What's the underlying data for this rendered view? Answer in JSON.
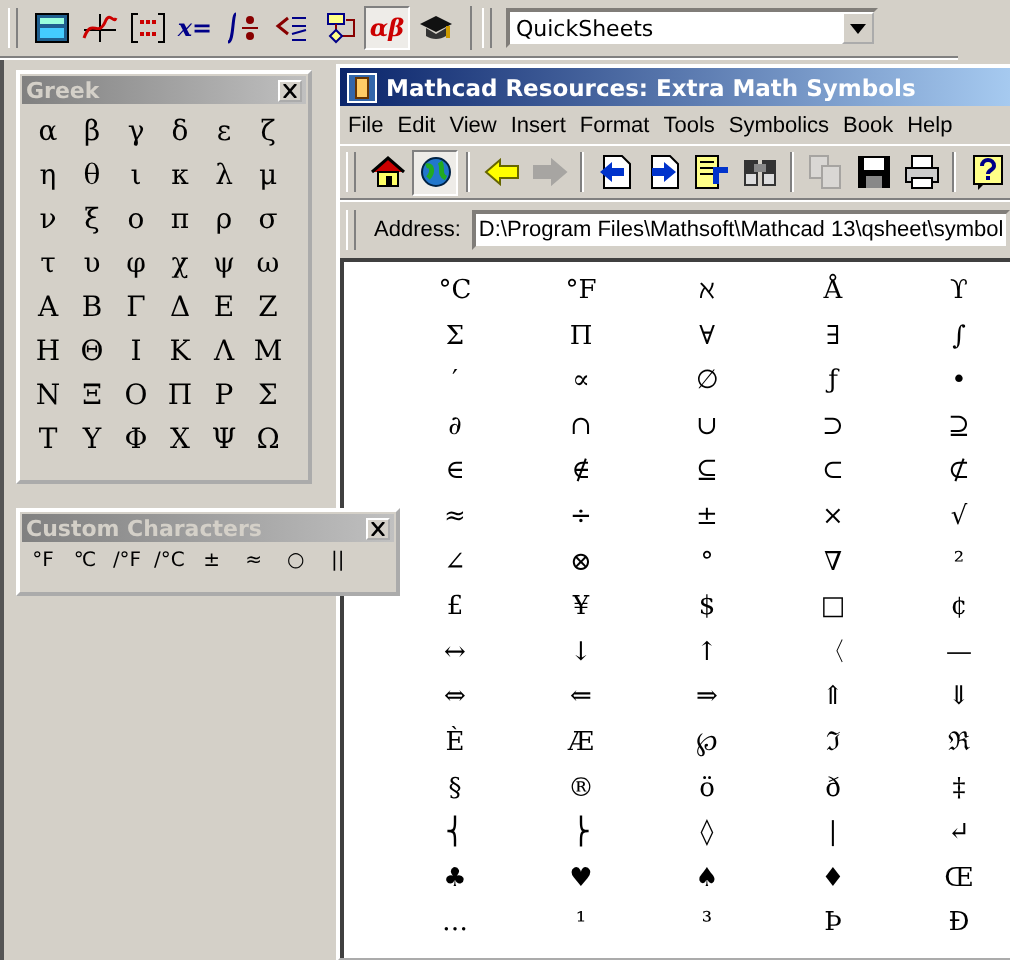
{
  "math_toolbar": [
    {
      "kind": "calculator",
      "selected": false
    },
    {
      "kind": "graph",
      "selected": false
    },
    {
      "kind": "matrix",
      "selected": false
    },
    {
      "kind": "text",
      "label": "x=",
      "selected": false
    },
    {
      "kind": "calculus",
      "selected": false
    },
    {
      "kind": "boolean",
      "selected": false
    },
    {
      "kind": "programming",
      "selected": false
    },
    {
      "kind": "text",
      "label": "αβ",
      "selected": true
    },
    {
      "kind": "cap",
      "selected": false
    }
  ],
  "resources_dropdown": {
    "value": "QuickSheets"
  },
  "greek_palette": {
    "title": "Greek",
    "symbols": [
      "α",
      "β",
      "γ",
      "δ",
      "ε",
      "ζ",
      "η",
      "θ",
      "ι",
      "κ",
      "λ",
      "μ",
      "ν",
      "ξ",
      "ο",
      "π",
      "ρ",
      "σ",
      "τ",
      "υ",
      "φ",
      "χ",
      "ψ",
      "ω",
      "Α",
      "Β",
      "Γ",
      "Δ",
      "Ε",
      "Ζ",
      "Η",
      "Θ",
      "Ι",
      "Κ",
      "Λ",
      "Μ",
      "Ν",
      "Ξ",
      "Ο",
      "Π",
      "Ρ",
      "Σ",
      "Τ",
      "Υ",
      "Φ",
      "Χ",
      "Ψ",
      "Ω"
    ]
  },
  "custom_palette": {
    "title": "Custom Characters",
    "symbols": [
      "°F",
      "℃",
      "/°F",
      "/°C",
      "±",
      "≈",
      "○",
      "||"
    ]
  },
  "window": {
    "title": "Mathcad Resources: Extra Math Symbols",
    "menu": [
      "File",
      "Edit",
      "View",
      "Insert",
      "Format",
      "Tools",
      "Symbolics",
      "Book",
      "Help"
    ],
    "toolbar": [
      {
        "kind": "home",
        "selected": false,
        "disabled": false
      },
      {
        "kind": "globe",
        "selected": true,
        "disabled": false
      },
      {
        "kind": "sep"
      },
      {
        "kind": "back",
        "selected": false,
        "disabled": false
      },
      {
        "kind": "forward",
        "selected": false,
        "disabled": true
      },
      {
        "kind": "sep"
      },
      {
        "kind": "page-left",
        "selected": false,
        "disabled": false
      },
      {
        "kind": "page-right",
        "selected": false,
        "disabled": false
      },
      {
        "kind": "page-toc",
        "selected": false,
        "disabled": false
      },
      {
        "kind": "binoculars",
        "selected": false,
        "disabled": false
      },
      {
        "kind": "sep"
      },
      {
        "kind": "copy",
        "selected": false,
        "disabled": true
      },
      {
        "kind": "save",
        "selected": false,
        "disabled": false
      },
      {
        "kind": "print",
        "selected": false,
        "disabled": false
      },
      {
        "kind": "sep"
      },
      {
        "kind": "help",
        "selected": false,
        "disabled": false
      }
    ],
    "address": {
      "label": "Address:",
      "value": "D:\\Program Files\\Mathsoft\\Mathcad 13\\qsheet\\symbol"
    },
    "symbols": [
      [
        "°C",
        "°F",
        "ℵ",
        "Å",
        "ϒ"
      ],
      [
        "Σ",
        "Π",
        "∀",
        "∃",
        "∫"
      ],
      [
        "′",
        "∝",
        "∅",
        "ƒ",
        "•"
      ],
      [
        "∂",
        "∩",
        "∪",
        "⊃",
        "⊇"
      ],
      [
        "∈",
        "∉",
        "⊆",
        "⊂",
        "⊄"
      ],
      [
        "≈",
        "÷",
        "±",
        "×",
        "√"
      ],
      [
        "∠",
        "⊗",
        "°",
        "∇",
        "²"
      ],
      [
        "£",
        "¥",
        "$",
        "□",
        "¢"
      ],
      [
        "↔",
        "↓",
        "↑",
        "〈",
        "—"
      ],
      [
        "⇔",
        "⇐",
        "⇒",
        "⇑",
        "⇓"
      ],
      [
        "È",
        "Æ",
        "℘",
        "ℑ",
        "ℜ"
      ],
      [
        "§",
        "®",
        "ö",
        "ð",
        "‡"
      ],
      [
        "⎨",
        "⎬",
        "◊",
        "|",
        "↵"
      ],
      [
        "♣",
        "♥",
        "♠",
        "♦",
        "Œ"
      ],
      [
        "…",
        "¹",
        "³",
        "Þ",
        "Đ"
      ]
    ]
  }
}
